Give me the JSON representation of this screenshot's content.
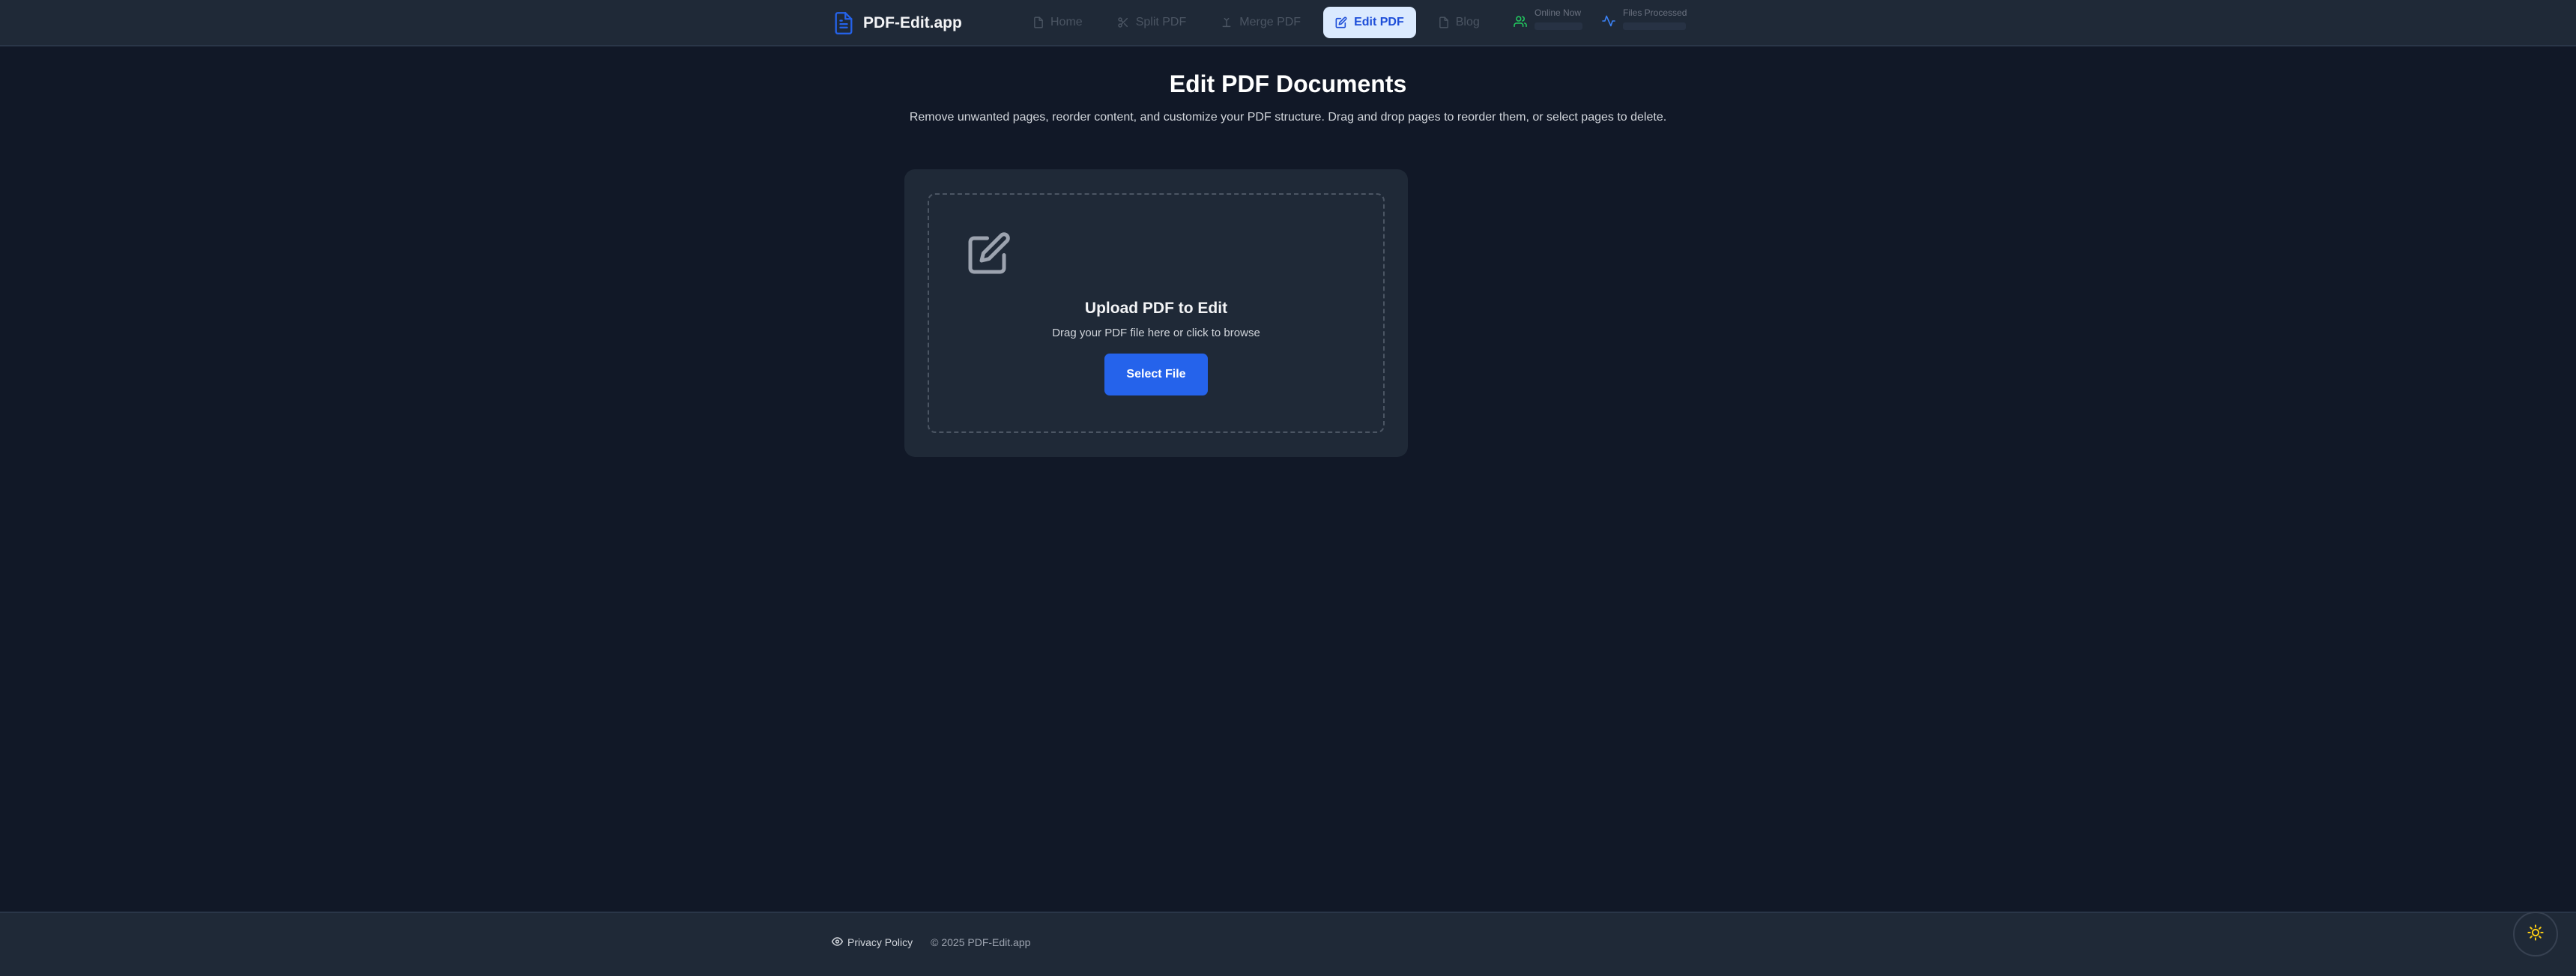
{
  "header": {
    "brand": {
      "name": "PDF-Edit.app",
      "icon": "document-icon",
      "color": "#2563eb"
    },
    "nav": [
      {
        "label": "Home",
        "icon": "document-icon",
        "active": false
      },
      {
        "label": "Split PDF",
        "icon": "scissors-icon",
        "active": false
      },
      {
        "label": "Merge PDF",
        "icon": "merge-icon",
        "active": false
      },
      {
        "label": "Edit PDF",
        "icon": "edit-icon",
        "active": true
      },
      {
        "label": "Blog",
        "icon": "document-icon",
        "active": false
      }
    ],
    "stats": [
      {
        "label": "Online Now",
        "icon": "users-icon",
        "color": "#22c55e"
      },
      {
        "label": "Files Processed",
        "icon": "activity-icon",
        "color": "#3b82f6"
      }
    ]
  },
  "main": {
    "title": "Edit PDF Documents",
    "description": "Remove unwanted pages, reorder content, and customize your PDF structure. Drag and drop pages to reorder them, or select pages to delete.",
    "upload": {
      "icon": "edit-icon",
      "title": "Upload PDF to Edit",
      "hint": "Drag your PDF file here or click to browse",
      "button_label": "Select File"
    }
  },
  "footer": {
    "privacy_label": "Privacy Policy",
    "privacy_icon": "eye-icon",
    "copyright": "© 2025 PDF-Edit.app"
  },
  "theme_toggle": {
    "icon": "sun-icon",
    "color": "#facc15"
  },
  "colors": {
    "background": "#111827",
    "surface": "#1f2937",
    "accent": "#2563eb",
    "active_tab_bg": "#dbeafe"
  }
}
